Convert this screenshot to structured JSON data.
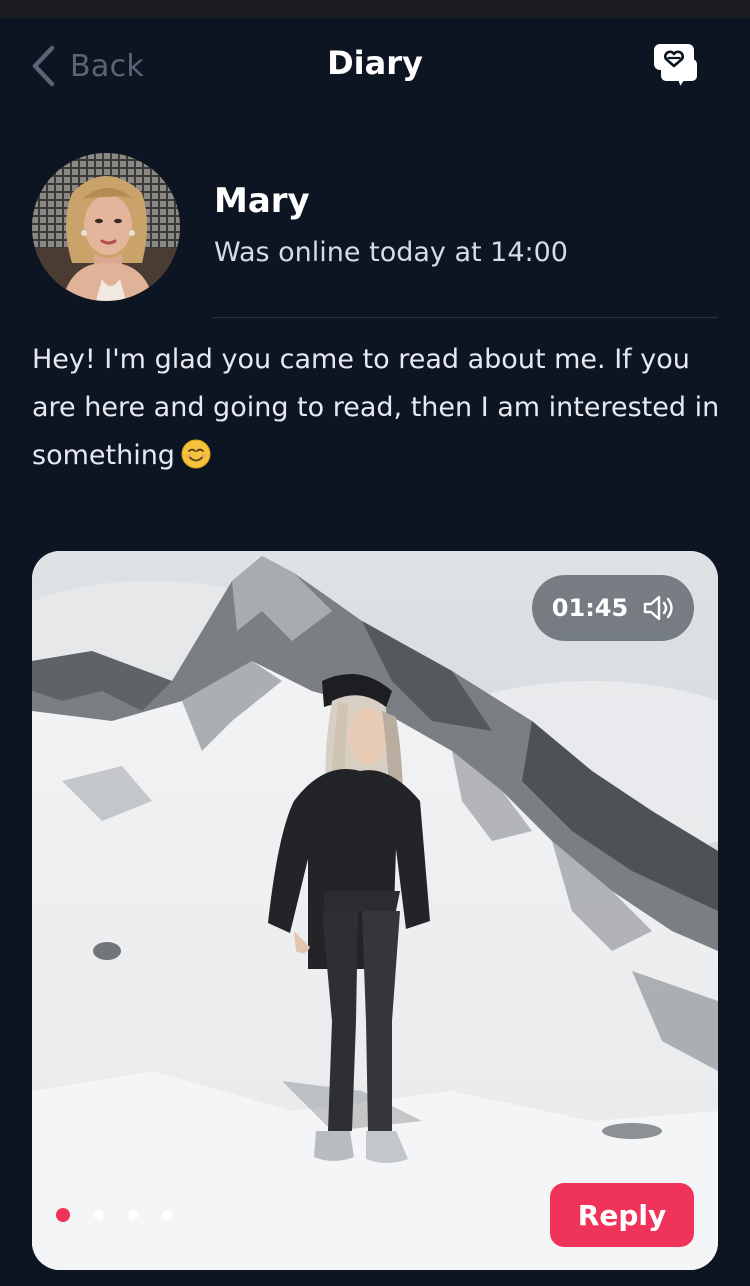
{
  "nav": {
    "back_label": "Back",
    "title": "Diary",
    "chat_icon": "heart-chat-icon"
  },
  "profile": {
    "name": "Mary",
    "status": "Was online today at 14:00"
  },
  "bio": {
    "text": "Hey! I'm glad you came to read about me. If you are here and going to read, then I am interested in something",
    "emoji": "smiling-face-emoji"
  },
  "media": {
    "audio_time": "01:45",
    "audio_icon": "speaker-icon",
    "slide_count": 4,
    "active_slide": 1,
    "reply_label": "Reply"
  },
  "colors": {
    "background": "#0e1522",
    "accent": "#f0335a",
    "muted": "#5b6475"
  }
}
